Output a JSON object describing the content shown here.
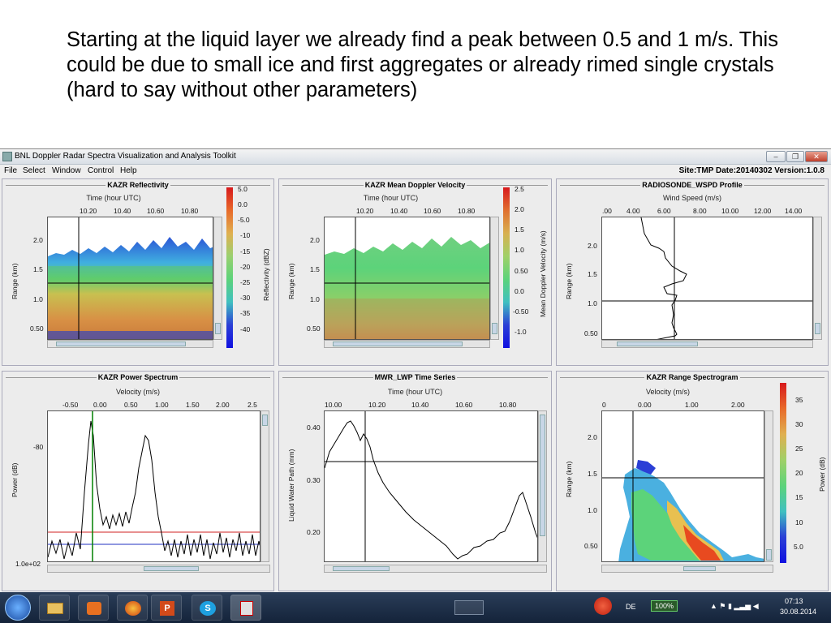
{
  "slide": {
    "text": "Starting at the liquid layer we already find a peak between 0.5 and 1 m/s. This could be due to small ice and first aggregates or already rimed single crystals (hard to say without other parameters)"
  },
  "window": {
    "title": "BNL Doppler Radar Spectra Visualization and Analysis Toolkit",
    "minimize": "–",
    "restore": "❐",
    "close": "✕"
  },
  "menu": [
    "File",
    "Select",
    "Window",
    "Control",
    "Help"
  ],
  "siteinfo": "Site:TMP  Date:20140302  Version:1.0.8",
  "panels": {
    "p1": {
      "title": "KAZR Reflectivity",
      "xaxis": "Time (hour UTC)",
      "ylabel": "Range (km)",
      "xticks": [
        "10.20",
        "10.40",
        "10.60",
        "10.80"
      ],
      "yticks": [
        "2.0",
        "1.5",
        "1.0",
        "0.50"
      ],
      "cbar_label": "Reflectivity (dBZ)",
      "cbar_ticks": [
        "5.0",
        "0.0",
        "-5.0",
        "-10",
        "-15",
        "-20",
        "-25",
        "-30",
        "-35",
        "-40"
      ]
    },
    "p2": {
      "title": "KAZR Mean Doppler Velocity",
      "xaxis": "Time (hour UTC)",
      "ylabel": "Range (km)",
      "xticks": [
        "10.20",
        "10.40",
        "10.60",
        "10.80"
      ],
      "yticks": [
        "2.0",
        "1.5",
        "1.0",
        "0.50"
      ],
      "cbar_label": "Mean Doppler Velocity (m/s)",
      "cbar_ticks": [
        "2.5",
        "2.0",
        "1.5",
        "1.0",
        "0.50",
        "0.0",
        "-0.50",
        "-1.0"
      ]
    },
    "p3": {
      "title": "RADIOSONDE_WSPD Profile",
      "xaxis": "Wind Speed (m/s)",
      "ylabel": "Range (km)",
      "xticks": [
        ".00",
        "4.00",
        "6.00",
        "8.00",
        "10.00",
        "12.00",
        "14.00"
      ],
      "yticks": [
        "2.0",
        "1.5",
        "1.0",
        "0.50"
      ]
    },
    "p4": {
      "title": "KAZR Power Spectrum",
      "xaxis": "Velocity (m/s)",
      "ylabel": "Power (dB)",
      "xticks": [
        "-0.50",
        "0.00",
        "0.50",
        "1.00",
        "1.50",
        "2.00",
        "2.5"
      ],
      "yticks": [
        "-80",
        "1.0e+02"
      ]
    },
    "p5": {
      "title": "MWR_LWP Time Series",
      "xaxis": "Time (hour UTC)",
      "ylabel": "Liquid Water Path (mm)",
      "xticks": [
        "10.00",
        "10.20",
        "10.40",
        "10.60",
        "10.80"
      ],
      "yticks": [
        "0.40",
        "0.30",
        "0.20"
      ]
    },
    "p6": {
      "title": "KAZR Range Spectrogram",
      "xaxis": "Velocity (m/s)",
      "ylabel": "Range (km)",
      "xticks": [
        "0",
        "0.00",
        "1.00",
        "2.00"
      ],
      "yticks": [
        "2.0",
        "1.5",
        "1.0",
        "0.50"
      ],
      "cbar_label": "Power (dB)",
      "cbar_ticks": [
        "35",
        "30",
        "25",
        "20",
        "15",
        "10",
        "5.0"
      ]
    }
  },
  "taskbar": {
    "lang": "DE",
    "battery": "100%",
    "time": "07:13",
    "date": "30.08.2014"
  },
  "colors": {
    "jet_red": "#d7191c",
    "jet_yellow": "#f0d060",
    "jet_green": "#5cd37a",
    "jet_blue": "#2b3fd6",
    "refl_orange": "#d89045",
    "line_black": "#000000",
    "spectrum_red": "#d02020",
    "spectrum_blue": "#2030c0",
    "spectrum_green": "#008000"
  }
}
